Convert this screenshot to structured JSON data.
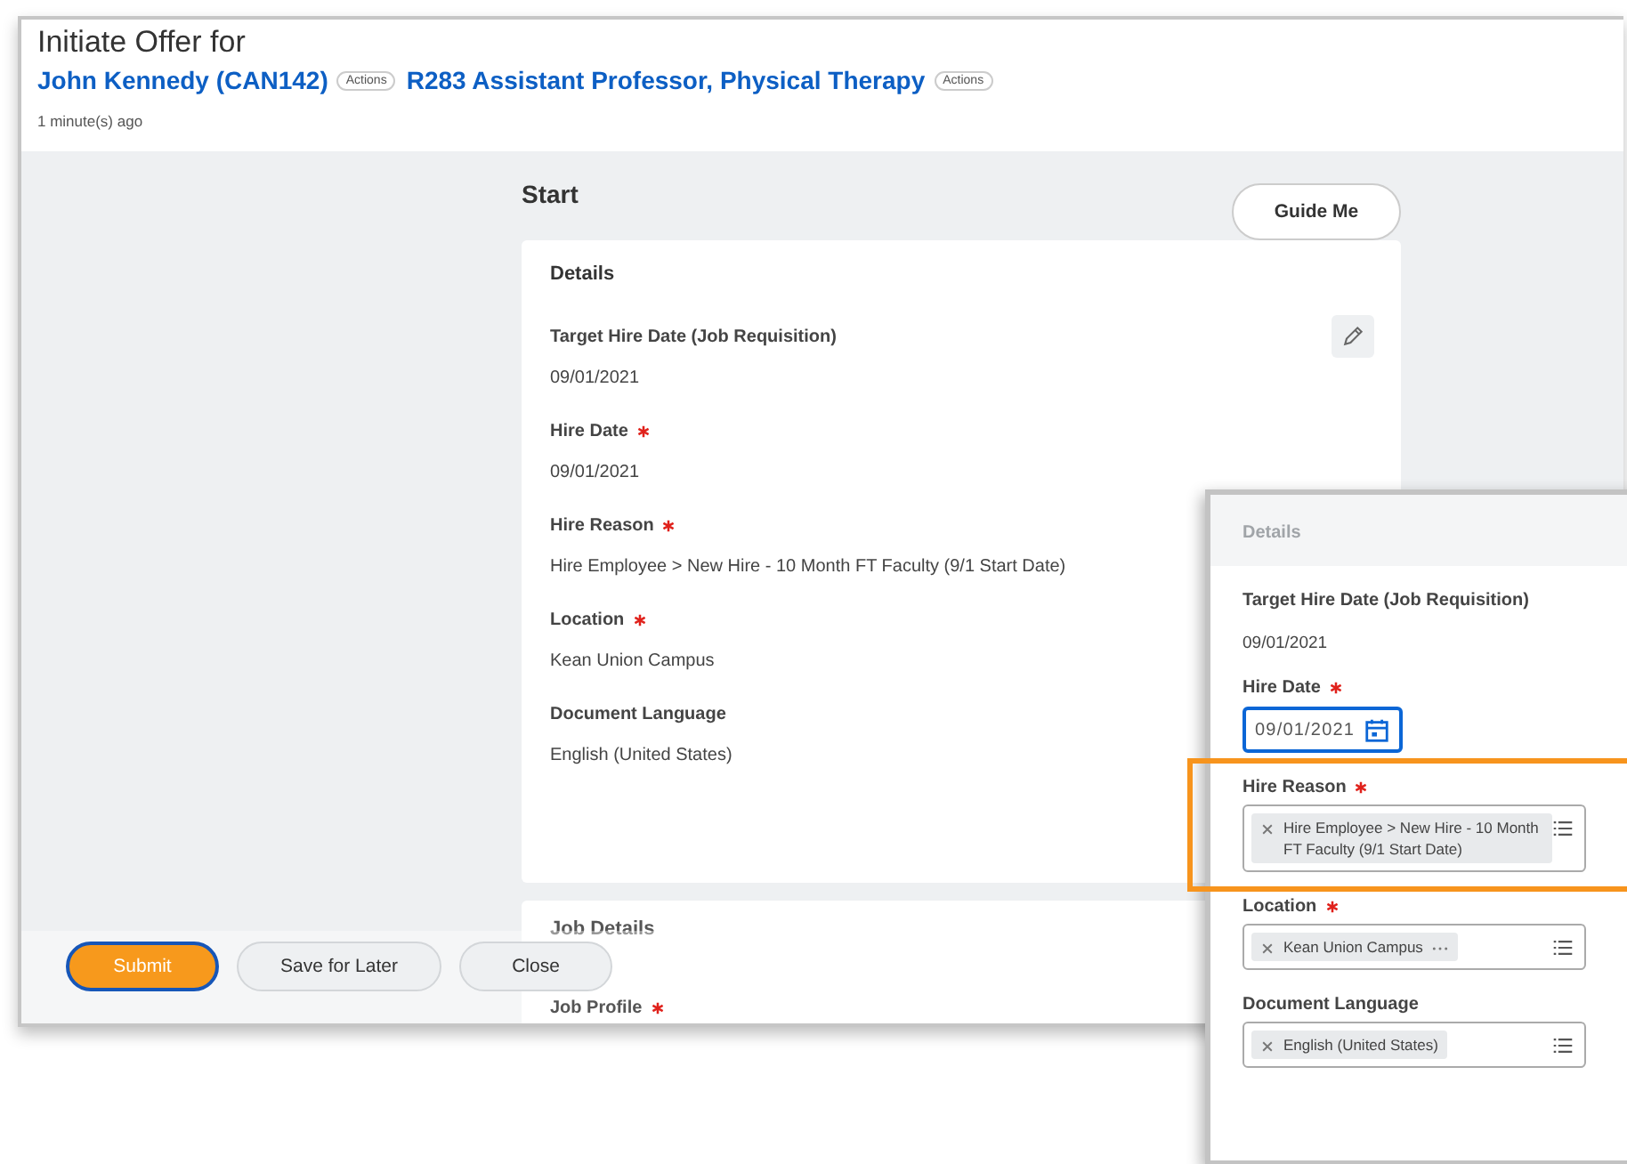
{
  "header": {
    "title": "Initiate Offer for",
    "links": [
      {
        "text": "John Kennedy (CAN142)",
        "badge": "Actions"
      },
      {
        "text": "R283 Assistant Professor, Physical Therapy",
        "badge": "Actions"
      }
    ],
    "timestamp": "1 minute(s) ago"
  },
  "section_title": "Start",
  "guide_button": "Guide Me",
  "details_card": {
    "title": "Details",
    "fields": [
      {
        "label": "Target Hire Date (Job Requisition)",
        "value": "09/01/2021",
        "required": false,
        "editable": true
      },
      {
        "label": "Hire Date",
        "value": "09/01/2021",
        "required": true,
        "editable": false
      },
      {
        "label": "Hire Reason",
        "value": "Hire Employee > New Hire - 10 Month FT Faculty (9/1 Start Date)",
        "required": true,
        "editable": false
      },
      {
        "label": "Location",
        "value": "Kean Union Campus",
        "required": true,
        "editable": false
      },
      {
        "label": "Document Language",
        "value": "English (United States)",
        "required": false,
        "editable": false
      }
    ]
  },
  "job_details_card": {
    "title": "Job Details",
    "fields": [
      {
        "label": "Job Profile",
        "required": true
      }
    ]
  },
  "footer_buttons": [
    {
      "label": "Submit",
      "kind": "primary"
    },
    {
      "label": "Save for Later",
      "kind": "secondary"
    },
    {
      "label": "Close",
      "kind": "secondary"
    }
  ],
  "inset": {
    "title": "Details",
    "fields": [
      {
        "kind": "text",
        "label": "Target Hire Date (Job Requisition)",
        "value": "09/01/2021",
        "required": false,
        "highlighted": false
      },
      {
        "kind": "date",
        "label": "Hire Date",
        "value": "09/01/2021",
        "required": true,
        "focused": true,
        "highlighted": false
      },
      {
        "kind": "multiselect",
        "label": "Hire Reason",
        "required": true,
        "highlighted": true,
        "chips": [
          {
            "text": "Hire Employee > New Hire - 10 Month FT Faculty (9/1 Start Date)",
            "more": false
          }
        ]
      },
      {
        "kind": "multiselect",
        "label": "Location",
        "required": true,
        "highlighted": false,
        "chips": [
          {
            "text": "Kean Union Campus",
            "more": true
          }
        ]
      },
      {
        "kind": "multiselect",
        "label": "Document Language",
        "required": false,
        "highlighted": false,
        "chips": [
          {
            "text": "English (United States)",
            "more": false
          }
        ]
      }
    ]
  }
}
